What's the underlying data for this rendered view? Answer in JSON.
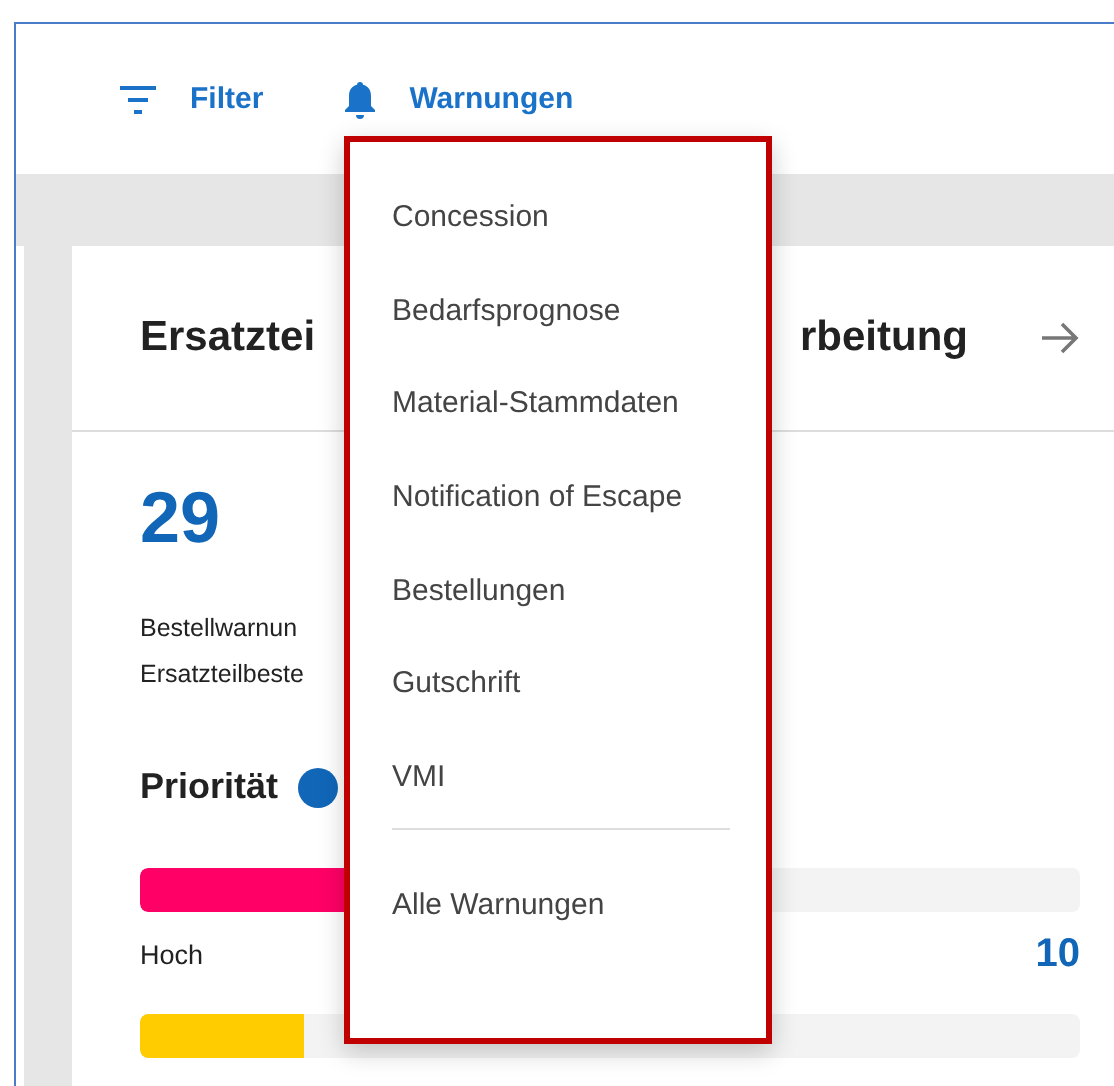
{
  "toolbar": {
    "filter_label": "Filter",
    "warnings_label": "Warnungen"
  },
  "card": {
    "title_start": "Ersatztei",
    "title_end": "rbeitung",
    "count": "29",
    "description_lines": [
      "Bestellwarnun",
      "Ersatzteilbeste"
    ],
    "priority_heading": "Priorität",
    "bars": [
      {
        "label": "Hoch",
        "value": "10",
        "color": "#ff0066",
        "level": 0.3
      },
      {
        "color": "#ffcc00",
        "level": 0.175
      }
    ]
  },
  "menu": {
    "items": [
      {
        "label": "Concession",
        "kind": "item"
      },
      {
        "label": "Bedarfsprognose",
        "kind": "item"
      },
      {
        "label": "Material-Stammdaten",
        "kind": "item"
      },
      {
        "label": "Notification of Escape",
        "kind": "item"
      },
      {
        "label": "Bestellungen",
        "kind": "item"
      },
      {
        "label": "Gutschrift",
        "kind": "item"
      },
      {
        "label": "VMI",
        "kind": "item"
      },
      {
        "kind": "divider"
      },
      {
        "label": "Alle Warnungen",
        "kind": "item"
      }
    ]
  }
}
